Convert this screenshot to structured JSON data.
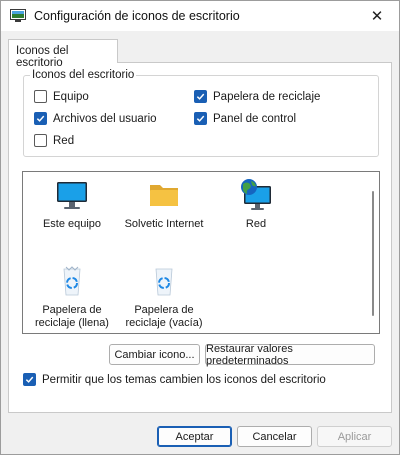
{
  "window": {
    "title": "Configuración de iconos de escritorio",
    "close_glyph": "✕"
  },
  "tabs": [
    {
      "label": "Iconos del escritorio",
      "selected": true
    }
  ],
  "group": {
    "legend": "Iconos del escritorio",
    "checkboxes": [
      {
        "label": "Equipo",
        "checked": false
      },
      {
        "label": "Papelera de reciclaje",
        "checked": true
      },
      {
        "label": "Archivos del usuario",
        "checked": true
      },
      {
        "label": "Panel de control",
        "checked": true
      },
      {
        "label": "Red",
        "checked": false
      }
    ]
  },
  "icon_list": {
    "items": [
      {
        "label": "Este equipo",
        "icon": "monitor-icon"
      },
      {
        "label": "Solvetic Internet",
        "icon": "folder-icon"
      },
      {
        "label": "Red",
        "icon": "network-globe-icon"
      },
      {
        "label": "Papelera de reciclaje (llena)",
        "icon": "recycle-bin-full-icon"
      },
      {
        "label": "Papelera de reciclaje (vacía)",
        "icon": "recycle-bin-empty-icon"
      }
    ]
  },
  "buttons": {
    "change_icon": "Cambiar icono...",
    "restore_defaults": "Restaurar valores predeterminados",
    "accept": "Aceptar",
    "cancel": "Cancelar",
    "apply": "Aplicar"
  },
  "themes_checkbox": {
    "label": "Permitir que los temas cambien los iconos del escritorio",
    "checked": true
  },
  "colors": {
    "accent": "#1a5fb4",
    "folder": "#f5c242",
    "monitor": "#1aa0e8"
  }
}
